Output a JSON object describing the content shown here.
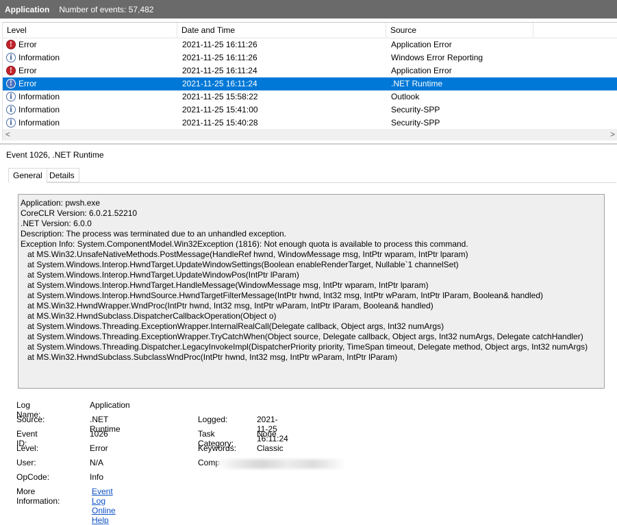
{
  "header": {
    "log_name": "Application",
    "events_label": "Number of events: 57,482"
  },
  "grid": {
    "columns": [
      "Level",
      "Date and Time",
      "Source"
    ],
    "rows": [
      {
        "level": "Error",
        "icon": "error-icon",
        "datetime": "2021-11-25 16:11:26",
        "source": "Application Error",
        "selected": false
      },
      {
        "level": "Information",
        "icon": "info-icon",
        "datetime": "2021-11-25 16:11:26",
        "source": "Windows Error Reporting",
        "selected": false
      },
      {
        "level": "Error",
        "icon": "error-icon",
        "datetime": "2021-11-25 16:11:24",
        "source": "Application Error",
        "selected": false
      },
      {
        "level": "Error",
        "icon": "error-icon",
        "datetime": "2021-11-25 16:11:24",
        "source": ".NET Runtime",
        "selected": true
      },
      {
        "level": "Information",
        "icon": "info-icon",
        "datetime": "2021-11-25 15:58:22",
        "source": "Outlook",
        "selected": false
      },
      {
        "level": "Information",
        "icon": "info-icon",
        "datetime": "2021-11-25 15:41:00",
        "source": "Security-SPP",
        "selected": false
      },
      {
        "level": "Information",
        "icon": "info-icon",
        "datetime": "2021-11-25 15:40:28",
        "source": "Security-SPP",
        "selected": false
      }
    ],
    "scroll_left": "<",
    "scroll_right": ">"
  },
  "detail": {
    "title": "Event 1026, .NET Runtime",
    "tabs": [
      "General",
      "Details"
    ],
    "description": "Application: pwsh.exe\nCoreCLR Version: 6.0.21.52210\n.NET Version: 6.0.0\nDescription: The process was terminated due to an unhandled exception.\nException Info: System.ComponentModel.Win32Exception (1816): Not enough quota is available to process this command.\n   at MS.Win32.UnsafeNativeMethods.PostMessage(HandleRef hwnd, WindowMessage msg, IntPtr wparam, IntPtr lparam)\n   at System.Windows.Interop.HwndTarget.UpdateWindowSettings(Boolean enableRenderTarget, Nullable`1 channelSet)\n   at System.Windows.Interop.HwndTarget.UpdateWindowPos(IntPtr lParam)\n   at System.Windows.Interop.HwndTarget.HandleMessage(WindowMessage msg, IntPtr wparam, IntPtr lparam)\n   at System.Windows.Interop.HwndSource.HwndTargetFilterMessage(IntPtr hwnd, Int32 msg, IntPtr wParam, IntPtr lParam, Boolean& handled)\n   at MS.Win32.HwndWrapper.WndProc(IntPtr hwnd, Int32 msg, IntPtr wParam, IntPtr lParam, Boolean& handled)\n   at MS.Win32.HwndSubclass.DispatcherCallbackOperation(Object o)\n   at System.Windows.Threading.ExceptionWrapper.InternalRealCall(Delegate callback, Object args, Int32 numArgs)\n   at System.Windows.Threading.ExceptionWrapper.TryCatchWhen(Object source, Delegate callback, Object args, Int32 numArgs, Delegate catchHandler)\n   at System.Windows.Threading.Dispatcher.LegacyInvokeImpl(DispatcherPriority priority, TimeSpan timeout, Delegate method, Object args, Int32 numArgs)\n   at MS.Win32.HwndSubclass.SubclassWndProc(IntPtr hwnd, Int32 msg, IntPtr wParam, IntPtr lParam)",
    "properties": {
      "log_name_label": "Log Name:",
      "log_name": "Application",
      "source_label": "Source:",
      "source": ".NET Runtime",
      "logged_label": "Logged:",
      "logged": "2021-11-25 16:11:24",
      "event_id_label": "Event ID:",
      "event_id": "1026",
      "task_category_label": "Task Category:",
      "task_category": "None",
      "level_label": "Level:",
      "level": "Error",
      "keywords_label": "Keywords:",
      "keywords": "Classic",
      "user_label": "User:",
      "user": "N/A",
      "computer_label": "Compu",
      "opcode_label": "OpCode:",
      "opcode": "Info",
      "more_info_label": "More Information:",
      "more_info_link": "Event Log Online Help"
    }
  },
  "colors": {
    "selection": "#0078d7",
    "titlebar": "#6a6a6a",
    "error": "#c4232a",
    "link": "#0b4fc6"
  }
}
